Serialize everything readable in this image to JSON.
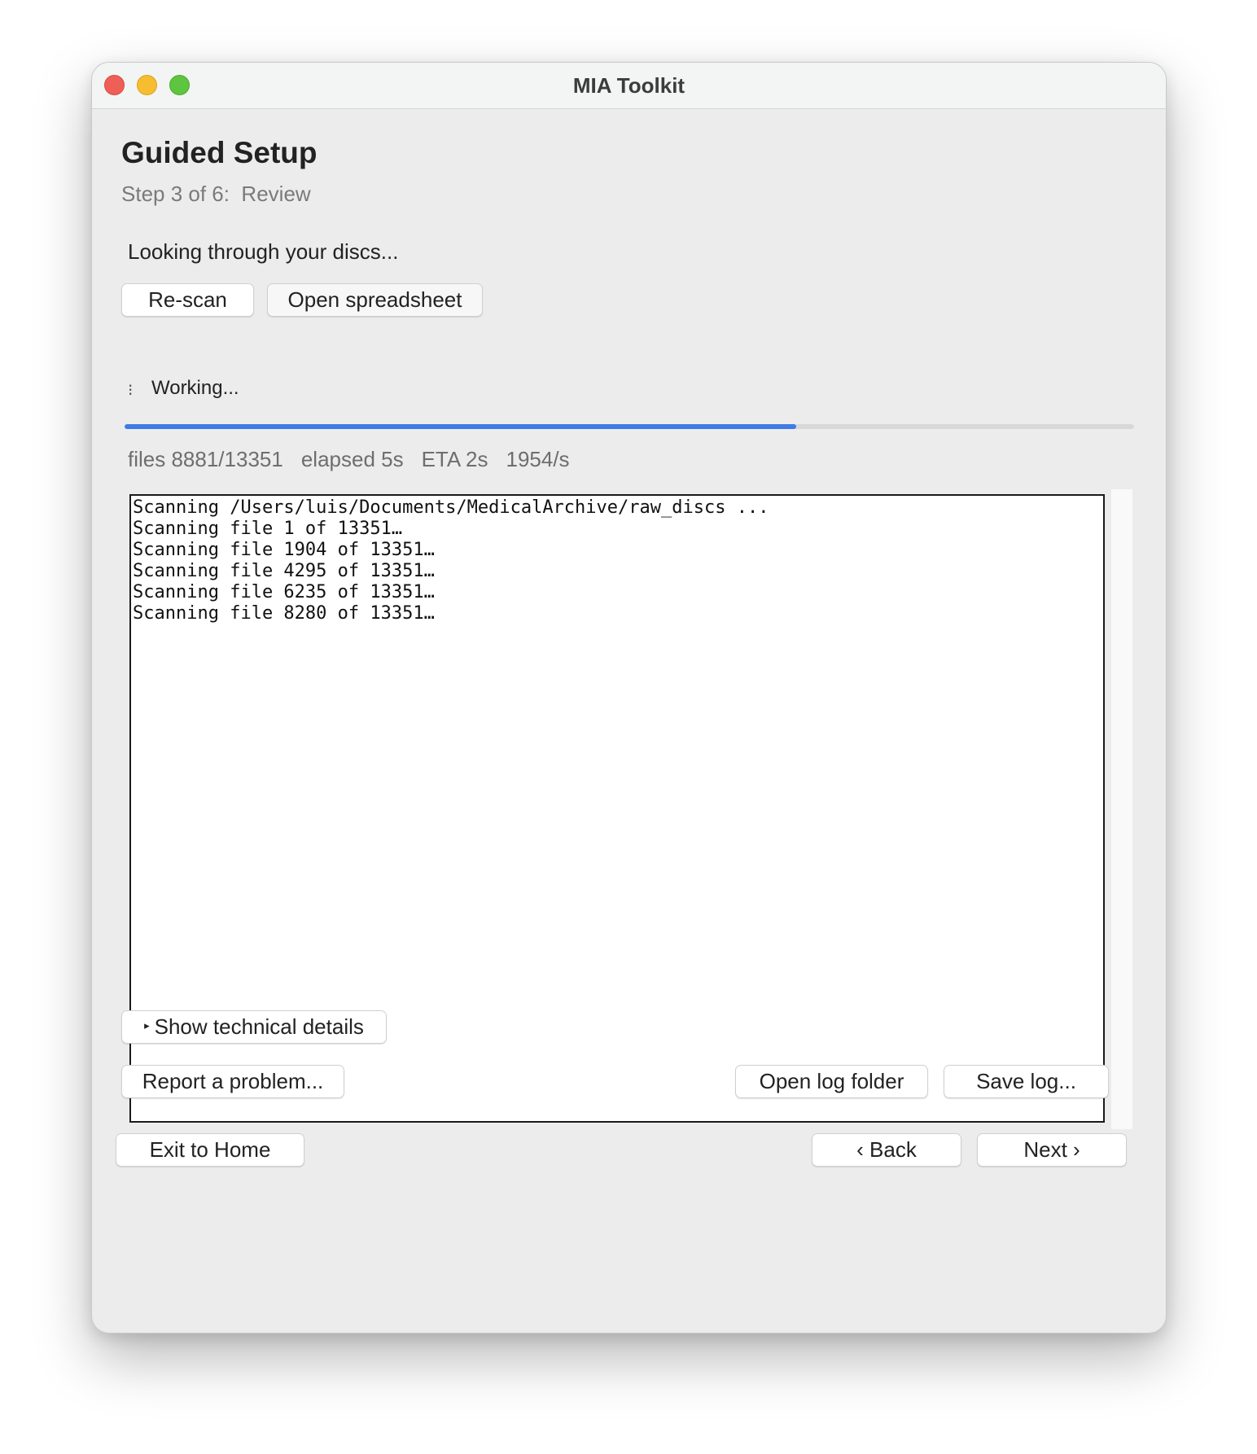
{
  "window": {
    "title": "MIA Toolkit"
  },
  "header": {
    "title": "Guided Setup",
    "step": "Step 3 of 6:  Review"
  },
  "status": {
    "message": "Looking through your discs...",
    "working_label": "Working...",
    "spinner_glyph": "⁝"
  },
  "actions": {
    "rescan_label": "Re-scan",
    "open_spreadsheet_label": "Open spreadsheet"
  },
  "progress": {
    "fraction": 0.6652
  },
  "stats": {
    "files": "files 8881/13351",
    "elapsed": "elapsed 5s",
    "eta": "ETA 2s",
    "rate": "1954/s"
  },
  "log": {
    "lines": [
      "Scanning /Users/luis/Documents/MedicalArchive/raw_discs ...",
      "Scanning file 1 of 13351…",
      "Scanning file 1904 of 13351…",
      "Scanning file 4295 of 13351…",
      "Scanning file 6235 of 13351…",
      "Scanning file 8280 of 13351…"
    ]
  },
  "details": {
    "toggle_glyph": "▸",
    "toggle_label": "Show technical details"
  },
  "support": {
    "report_label": "Report a problem...",
    "open_log_folder_label": "Open log folder",
    "save_log_label": "Save log..."
  },
  "footer": {
    "exit_label": "Exit to Home",
    "back_label": "‹ Back",
    "next_label": "Next ›"
  },
  "colors": {
    "progress_fill": "#3f7be6",
    "close": "#ee5f57",
    "minimize": "#f5bd2f",
    "maximize": "#5fc43f"
  }
}
